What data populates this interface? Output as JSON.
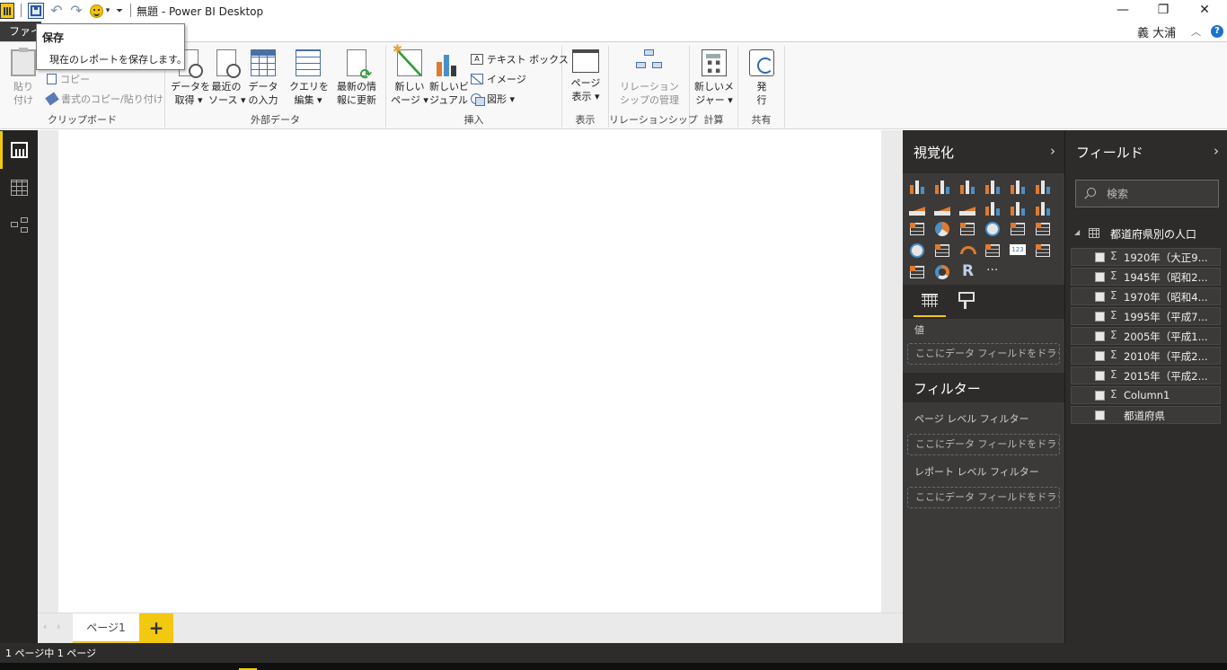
{
  "window": {
    "title": "無題 - Power BI Desktop",
    "minimize": "—",
    "restore": "❐",
    "close": "✕"
  },
  "qat": {
    "undo": "↶",
    "redo": "↷",
    "dropdown": "▾",
    "customize": "⏷"
  },
  "tabs": {
    "file": "ファイル"
  },
  "user": {
    "name": "義 大浦",
    "collapse": "︿",
    "help": "?"
  },
  "tooltip": {
    "title": "保存",
    "body": "現在のレポートを保存します。"
  },
  "ribbon": {
    "clipboard": {
      "label": "クリップボード",
      "paste": "貼り\n付け",
      "copy": "コピー",
      "format_painter": "書式のコピー/貼り付け"
    },
    "external_data": {
      "label": "外部データ",
      "get_data": "データを\n取得 ▾",
      "recent_sources": "最近の\nソース ▾",
      "enter_data": "データ\nの入力",
      "edit_queries": "クエリを\n編集 ▾",
      "refresh": "最新の情\n報に更新"
    },
    "insert": {
      "label": "挿入",
      "new_page": "新しい\nページ ▾",
      "new_visual": "新しいビ\nジュアル",
      "text_box": "テキスト ボックス",
      "image": "イメージ",
      "shapes": "図形 ▾"
    },
    "view": {
      "label": "表示",
      "page_view": "ページ\n表示 ▾"
    },
    "relationships": {
      "label": "リレーションシップ",
      "manage": "リレーション\nシップの管理"
    },
    "calculations": {
      "label": "計算",
      "new_measure": "新しいメ\nジャー ▾"
    },
    "share": {
      "label": "共有",
      "publish": "発\n行"
    }
  },
  "visualizations": {
    "title": "視覚化",
    "chevron": "›",
    "more": "···",
    "values_label": "値",
    "values_drop": "ここにデータ フィールドをドラッグし...",
    "filters_title": "フィルター",
    "page_filter_label": "ページ レベル フィルター",
    "page_filter_drop": "ここにデータ フィールドをドラッグ...",
    "report_filter_label": "レポート レベル フィルター",
    "report_filter_drop": "ここにデータ フィールドをドラッグ...",
    "r_label": "R",
    "number_card": "123"
  },
  "fields": {
    "title": "フィールド",
    "chevron": "›",
    "search_placeholder": "検索",
    "table_expand": "◢",
    "table_name": "都道府県別の人口",
    "items": [
      {
        "sigma": "Σ",
        "name": "1920年（大正9..."
      },
      {
        "sigma": "Σ",
        "name": "1945年（昭和2..."
      },
      {
        "sigma": "Σ",
        "name": "1970年（昭和4..."
      },
      {
        "sigma": "Σ",
        "name": "1995年（平成7..."
      },
      {
        "sigma": "Σ",
        "name": "2005年（平成1..."
      },
      {
        "sigma": "Σ",
        "name": "2010年（平成2..."
      },
      {
        "sigma": "Σ",
        "name": "2015年（平成2..."
      },
      {
        "sigma": "Σ",
        "name": "Column1"
      },
      {
        "sigma": "",
        "name": "都道府県"
      }
    ]
  },
  "pages": {
    "prev": "‹",
    "next": "›",
    "tab1": "ページ1",
    "add": "+"
  },
  "status": {
    "text": "1 ページ中 1 ページ"
  },
  "colors": {
    "accent": "#f2c811",
    "dark_pane": "#2d2c2b",
    "pane": "#3b3a39",
    "nav": "#252423",
    "visual_orange": "#e07a2e",
    "visual_blue": "#4a90c8"
  }
}
